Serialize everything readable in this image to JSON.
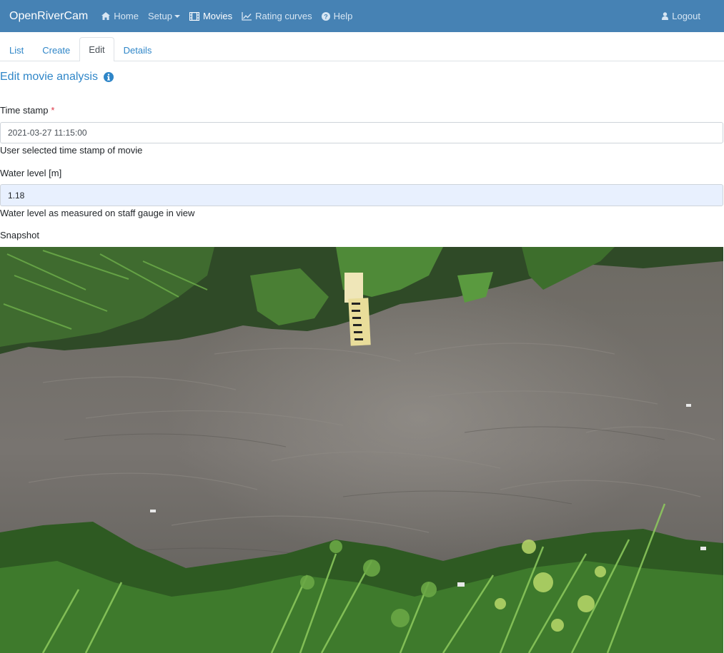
{
  "navbar": {
    "brand": "OpenRiverCam",
    "items": [
      {
        "label": "Home",
        "icon": "home-icon"
      },
      {
        "label": "Setup",
        "icon": "none"
      },
      {
        "label": "Movies",
        "icon": "film-icon"
      },
      {
        "label": "Rating curves",
        "icon": "line-chart-icon"
      },
      {
        "label": "Help",
        "icon": "question-circle-icon"
      }
    ],
    "logout": "Logout"
  },
  "tabs": [
    {
      "label": "List"
    },
    {
      "label": "Create"
    },
    {
      "label": "Edit"
    },
    {
      "label": "Details"
    }
  ],
  "page": {
    "title": "Edit movie analysis"
  },
  "form": {
    "timestamp": {
      "label": "Time stamp",
      "required_mark": "*",
      "value": "2021-03-27 11:15:00",
      "help": "User selected time stamp of movie"
    },
    "water_level": {
      "label": "Water level [m]",
      "value": "1.18",
      "help": "Water level as measured on staff gauge in view"
    },
    "snapshot": {
      "label": "Snapshot"
    }
  },
  "colors": {
    "navbar": "#4682b4",
    "link": "#2f86c8",
    "required": "#dc3545",
    "autofill": "#e8f0fe"
  }
}
